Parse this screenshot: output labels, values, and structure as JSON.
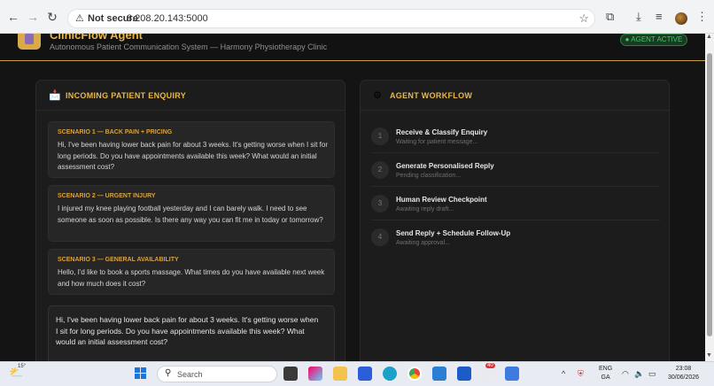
{
  "browser": {
    "not_secure": "Not secure",
    "url": "8.208.20.143:5000"
  },
  "header": {
    "title": "ClinicFlow Agent",
    "subtitle": "Autonomous Patient Communication System — Harmony Physiotherapy Clinic",
    "badge": "● AGENT ACTIVE"
  },
  "enquiry_panel": {
    "title": "INCOMING PATIENT ENQUIRY",
    "scenarios": [
      {
        "label": "SCENARIO 1 — BACK PAIN + PRICING",
        "text": "Hi, I've been having lower back pain for about 3 weeks. It's getting worse when I sit for long periods. Do you have appointments available this week? What would an initial assessment cost?"
      },
      {
        "label": "SCENARIO 2 — URGENT INJURY",
        "text": "I injured my knee playing football yesterday and I can barely walk. I need to see someone as soon as possible. Is there any way you can fit me in today or tomorrow?"
      },
      {
        "label": "SCENARIO 3 — GENERAL AVAILABILITY",
        "text": "Hello, I'd like to book a sports massage. What times do you have available next week and how much does it cost?"
      }
    ],
    "message_value": "Hi, I've been having lower back pain for about 3 weeks. It's getting worse when I sit for long periods. Do you have appointments available this week? What would an initial assessment cost?"
  },
  "workflow_panel": {
    "title": "AGENT WORKFLOW",
    "steps": [
      {
        "num": "1",
        "title": "Receive & Classify Enquiry",
        "status": "Waiting for patient message..."
      },
      {
        "num": "2",
        "title": "Generate Personalised Reply",
        "status": "Pending classification..."
      },
      {
        "num": "3",
        "title": "Human Review Checkpoint",
        "status": "Awaiting reply draft..."
      },
      {
        "num": "4",
        "title": "Send Reply + Schedule Follow-Up",
        "status": "Awaiting approval..."
      }
    ]
  },
  "taskbar": {
    "temperature": "15°",
    "search_label": "Search",
    "lang_1": "ENG",
    "lang_2": "GA",
    "time": "23:08",
    "date": "30/06/2026",
    "badge_count": "40"
  },
  "colors": {
    "accent": "#e8b84a",
    "active_green": "#4cc36b",
    "panel_bg": "#1c1c1c"
  }
}
